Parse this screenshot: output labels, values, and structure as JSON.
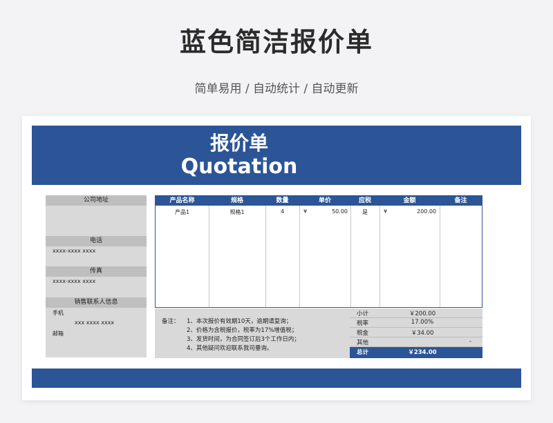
{
  "header": {
    "title": "蓝色简洁报价单",
    "subtitle": "简单易用 / 自动统计 / 自动更新"
  },
  "banner": {
    "title_cn": "报价单",
    "title_en": "Quotation"
  },
  "company": {
    "address_label": "公司地址",
    "address_value": "",
    "phone_label": "电话",
    "phone_value": "xxxx-xxxx xxxx",
    "fax_label": "传真",
    "fax_value": "xxxx-xxxx xxxx",
    "contact_label": "销售联系人信息",
    "mobile_label": "手机",
    "mobile_value": "xxx  xxxx xxxx",
    "email_label": "邮箱"
  },
  "table": {
    "columns": [
      "产品名称",
      "规格",
      "数量",
      "单价",
      "应税",
      "金额",
      "备注"
    ],
    "rows": [
      {
        "product": "产品1",
        "spec": "规格1",
        "qty": "4",
        "price_symbol": "¥",
        "price": "50.00",
        "taxable": "是",
        "amount_symbol": "¥",
        "amount": "200.00",
        "remark": ""
      }
    ]
  },
  "notes": {
    "label": "备注：",
    "lines": [
      "1、本次报价有效期10天，逾期请复询；",
      "2、价格为含税报价，税率为17%增值税；",
      "3、发货时间，为合同签订后3个工作日内；",
      "4、其他疑问欢迎联系我司垂询。"
    ]
  },
  "summary": {
    "subtotal_label": "小计",
    "subtotal_value": "￥200.00",
    "tax_rate_label": "税率",
    "tax_rate_value": "17.00%",
    "tax_amount_label": "税金",
    "tax_amount_value": "￥34.00",
    "other_label": "其他",
    "other_value": "-",
    "total_label": "总计",
    "total_value": "￥234.00"
  },
  "colors": {
    "accent": "#2c5597",
    "panel": "#d9d9d9",
    "label_bg": "#bfbfbf"
  }
}
